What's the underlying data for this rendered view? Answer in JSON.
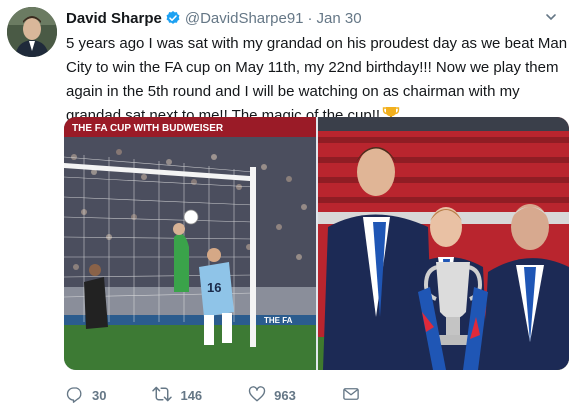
{
  "tweet": {
    "author_name": "David Sharpe",
    "handle": "@DavidSharpe91",
    "separator": "·",
    "date": "Jan 30",
    "text": "5 years ago I was sat with my grandad on his proudest day as we beat Man City to win the FA cup on May 11th, my 22nd birthday!!! Now we play them again in the 5th round and I will be watching on as chairman with my grandad sat next to me!! The magic of the cup!!",
    "banner_text_1": "THE FA CUP WITH BUDWEISER",
    "banner_text_2": "THE FA CUP WITH",
    "player_number": "16",
    "ad_board_text": "THE FA"
  },
  "actions": {
    "replies": "30",
    "retweets": "146",
    "likes": "963"
  },
  "colors": {
    "verified": "#1da1f2",
    "meta_gray": "#657786",
    "text": "#14171a"
  },
  "icons": [
    "verified-badge-icon",
    "chevron-down-icon",
    "trophy-emoji-icon",
    "reply-icon",
    "retweet-icon",
    "like-icon",
    "direct-message-icon"
  ]
}
